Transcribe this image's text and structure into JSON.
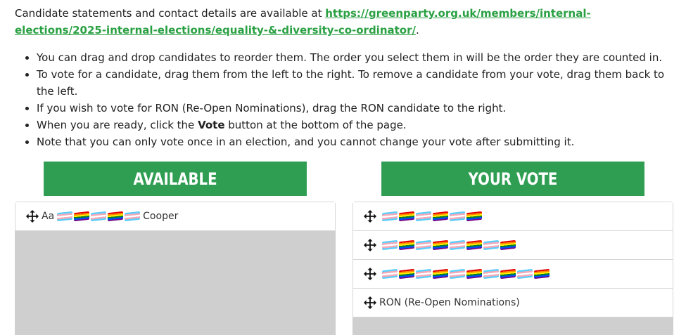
{
  "intro": {
    "text": "Candidate statements and contact details are available at ",
    "link": "https://greenparty.org.uk/members/internal-elections/2025-internal-elections/equality-&-diversity-co-ordinator/",
    "suffix": "."
  },
  "rules": {
    "r1": "You can drag and drop candidates to reorder them. The order you select them in will be the order they are counted in.",
    "r2": "To vote for a candidate, drag them from the left to the right. To remove a candidate from your vote, drag them back to the left.",
    "r3": "If you wish to vote for RON (Re-Open Nominations), drag the RON candidate to the right.",
    "r4_pre": "When you are ready, click the ",
    "r4_bold": "Vote",
    "r4_post": " button at the bottom of the page.",
    "r5": "Note that you can only vote once in an election, and you cannot change your vote after submitting it."
  },
  "available": {
    "title": "AVAILABLE",
    "candidate_prefix": "Aa",
    "candidate_suffix": "Cooper"
  },
  "your_vote": {
    "title": "YOUR VOTE",
    "ron_label": "RON (Re-Open Nominations)"
  },
  "icons": {
    "drag": "move-arrows-icon",
    "flags": [
      "trans-flag-icon",
      "rainbow-flag-icon"
    ]
  },
  "colors": {
    "accent": "#2f9e52",
    "link": "#2aa043",
    "dropzone": "#cfcfcf"
  }
}
